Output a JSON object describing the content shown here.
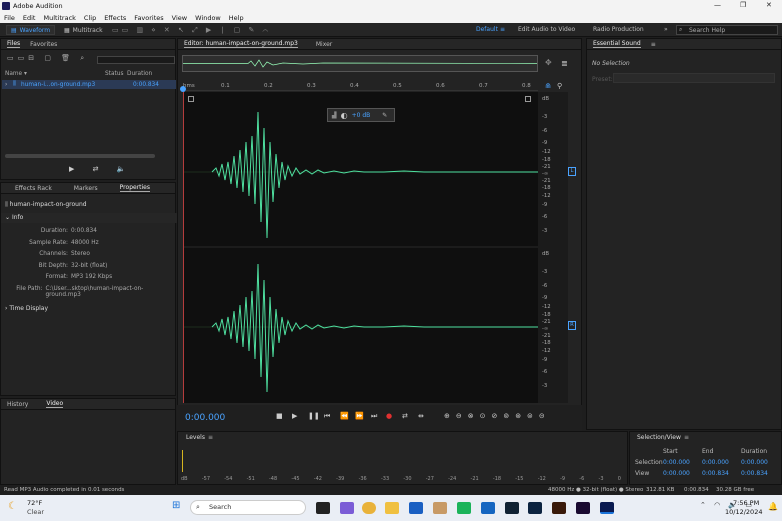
{
  "window": {
    "title": "Adobe Audition",
    "minimize": "—",
    "maximize": "❐",
    "close": "✕"
  },
  "menu": [
    "File",
    "Edit",
    "Multitrack",
    "Clip",
    "Effects",
    "Favorites",
    "View",
    "Window",
    "Help"
  ],
  "toolbar": {
    "waveform": "Waveform",
    "multitrack": "Multitrack"
  },
  "workspaces": {
    "default": "Default",
    "edit_video": "Edit Audio to Video",
    "radio": "Radio Production",
    "search_placeholder": "Search Help"
  },
  "files_panel": {
    "tab_files": "Files",
    "tab_favorites": "Favorites",
    "col_name": "Name ▾",
    "col_status": "Status",
    "col_duration": "Duration",
    "file_name": "human-i...on-ground.mp3",
    "file_duration": "0:00.834"
  },
  "properties_panel": {
    "tab_effects": "Effects Rack",
    "tab_markers": "Markers",
    "tab_properties": "Properties",
    "file_title": "human-impact-on-ground",
    "info_label": "Info",
    "rows": [
      {
        "k": "Duration:",
        "v": "0:00.834"
      },
      {
        "k": "Sample Rate:",
        "v": "48000 Hz"
      },
      {
        "k": "Channels:",
        "v": "Stereo"
      },
      {
        "k": "Bit Depth:",
        "v": "32-bit (float)"
      },
      {
        "k": "Format:",
        "v": "MP3 192 Kbps"
      },
      {
        "k": "File Path:",
        "v": "C:\\User...sktop\\human-impact-on-ground.mp3"
      }
    ],
    "time_display": "Time Display"
  },
  "history_panel": {
    "tab_history": "History",
    "tab_video": "Video"
  },
  "editor": {
    "tab": "Editor: human-impact-on-ground.mp3",
    "mixer": "Mixer",
    "ruler_unit": "hms",
    "ruler_ticks": [
      "0.1",
      "0.2",
      "0.3",
      "0.4",
      "0.5",
      "0.6",
      "0.7",
      "0.8"
    ],
    "hud_value": "+0 dB",
    "ch_left": "L",
    "ch_right": "R",
    "db_ticks": [
      "dB",
      "-3",
      "-6",
      "-9",
      "-12",
      "-18",
      "-21",
      "-∞",
      "-21",
      "-18",
      "-12",
      "-9",
      "-6",
      "-3"
    ],
    "timecode": "0:00.000"
  },
  "levels": {
    "title": "Levels",
    "ticks": [
      "dB",
      "-57",
      "-54",
      "-51",
      "-48",
      "-45",
      "-42",
      "-39",
      "-36",
      "-33",
      "-30",
      "-27",
      "-24",
      "-21",
      "-18",
      "-15",
      "-12",
      "-9",
      "-6",
      "-3",
      "0"
    ]
  },
  "selection": {
    "title": "Selection/View",
    "col_start": "Start",
    "col_end": "End",
    "col_duration": "Duration",
    "row_sel": {
      "label": "Selection",
      "start": "0:00.000",
      "end": "0:00.000",
      "dur": "0:00.000"
    },
    "row_view": {
      "label": "View",
      "start": "0:00.000",
      "end": "0:00.834",
      "dur": "0:00.834"
    }
  },
  "essential": {
    "title": "Essential Sound",
    "no_sel": "No Selection",
    "preset": "Preset:"
  },
  "status": {
    "left": "Read MP3 Audio completed in 0.01 seconds",
    "format": "48000 Hz ● 32-bit (float) ● Stereo",
    "size": "312.81 KB",
    "dur": "0:00.834",
    "free": "30.28 GB free"
  },
  "taskbar": {
    "temp": "72°F",
    "cond": "Clear",
    "search": "Search",
    "time": "7:56 PM",
    "date": "10/12/2024"
  },
  "colors": {
    "accent": "#4aa3ff",
    "wave": "#4fe0a0",
    "bg": "#1e1e1e"
  }
}
